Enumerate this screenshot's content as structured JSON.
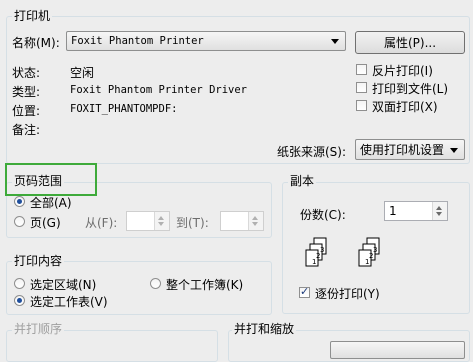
{
  "printer": {
    "legend": "打印机",
    "name_label": "名称(M):",
    "name_value": "Foxit Phantom Printer",
    "properties_button": "属性(P)...",
    "status_label": "状态:",
    "status_value": "空闲",
    "type_label": "类型:",
    "type_value": "Foxit Phantom Printer Driver",
    "location_label": "位置:",
    "location_value": "FOXIT_PHANTOMPDF:",
    "comment_label": "备注:",
    "reverse_print": "反片打印(I)",
    "print_to_file": "打印到文件(L)",
    "duplex_print": "双面打印(X)",
    "paper_source_label": "纸张来源(S):",
    "paper_source_value": "使用打印机设置"
  },
  "page_range": {
    "legend": "页码范围",
    "all": "全部(A)",
    "pages": "页(G)",
    "from_label": "从(F):",
    "to_label": "到(T):",
    "from_value": "",
    "to_value": ""
  },
  "copies": {
    "legend": "副本",
    "count_label": "份数(C):",
    "count_value": "1",
    "collate": "逐份打印(Y)",
    "stack1_pages": [
      "1",
      "2",
      "3"
    ],
    "stack2_pages": [
      "1",
      "2",
      "3"
    ]
  },
  "print_what": {
    "legend": "打印内容",
    "selection": "选定区域(N)",
    "entire_workbook": "整个工作簿(K)",
    "active_sheets": "选定工作表(V)"
  },
  "print_order": {
    "legend": "并打顺序"
  },
  "merge_zoom": {
    "legend": "并打和缩放"
  }
}
